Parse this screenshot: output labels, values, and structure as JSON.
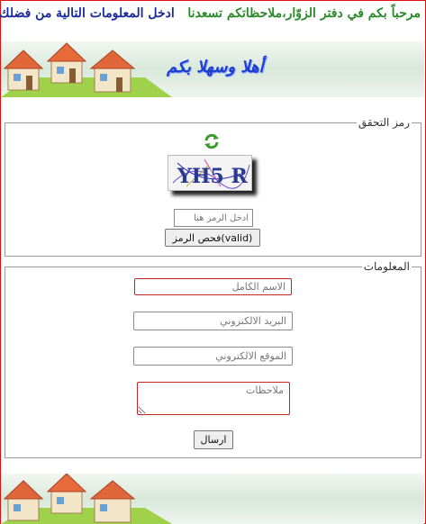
{
  "header": {
    "part1": "مرحباً بكم في دفتر الزوّار،ملاحظاتكم تسعدنا",
    "part2": "ادخل المعلومات التالية من فضلك"
  },
  "banner": {
    "welcome_text": "أهلا وسهلا بكم"
  },
  "verification": {
    "legend": "رمز التحقق",
    "captcha_text": "YH5 R",
    "code_placeholder": "ادخل الرمز هنا",
    "check_button": "فحص الرمز(valid)"
  },
  "info": {
    "legend": "المعلومات",
    "name_placeholder": "الاسم الكامل",
    "email_placeholder": "البريد الالكتروني",
    "site_placeholder": "الموقع الالكتروني",
    "notes_placeholder": "ملاحظات",
    "send_button": "ارسال"
  },
  "colors": {
    "header_green": "#2a8a2a",
    "header_blue": "#1a2a9a",
    "banner_text": "#1d3fd0",
    "required_border": "#c52424"
  }
}
